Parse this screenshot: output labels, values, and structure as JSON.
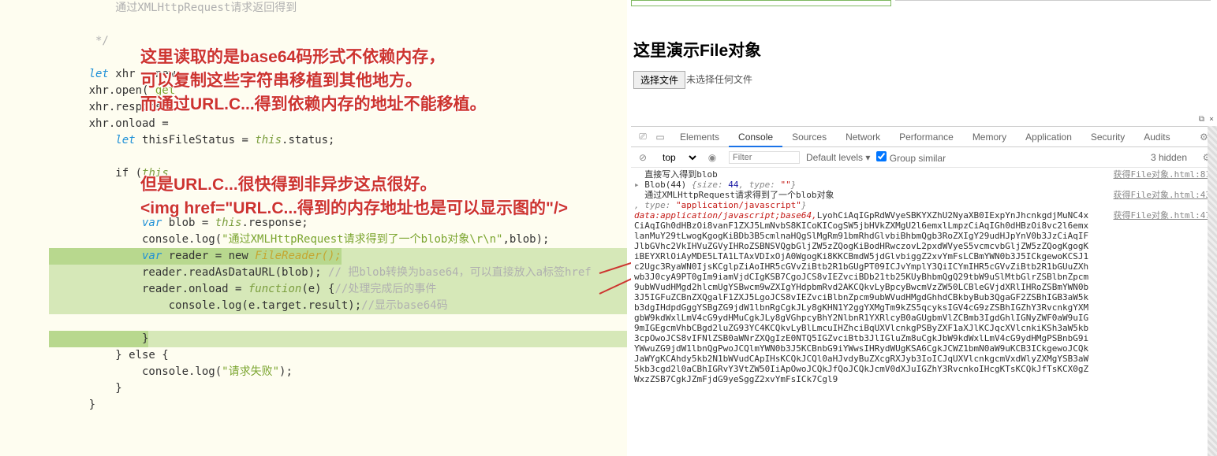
{
  "code": {
    "c1": "          通过XMLHttpRequest请求返回得到",
    "c2": "       */",
    "l1a": "      let ",
    "l1b": "xhr = new",
    "l2a": "      xhr.open(",
    "l2b": "'get",
    "l3": "      xhr.response",
    "l4": "      xhr.onload = ",
    "l5a": "          let ",
    "l5b": "thisFileStatus = ",
    "l5c": "this",
    "l5d": ".status;",
    "l6a": "          if (",
    "l6b": "this",
    "l7a": "              var ",
    "l7b": "blob = ",
    "l7c": "this",
    "l7d": ".response;",
    "l8a": "              console.log(",
    "l8b": "\"通过XMLHttpRequest请求得到了一个blob对象\\r\\n\"",
    "l8c": ",blob);",
    "l9a": "              var ",
    "l9b": "reader = new ",
    "l9c": "FileReader();",
    "l10a": "              reader.readAsDataURL(blob); ",
    "l10b": "// 把blob转换为base64，可以直接放入a标签href",
    "l11a": "              reader.onload = ",
    "l11b": "function",
    "l11c": "(e) {",
    "l11d": "//处理完成后的事件",
    "l12a": "                  console.log(e.target.result);",
    "l12b": "//显示base64码",
    "l13": "              }",
    "l14": "          } else {",
    "l15a": "              console.log(",
    "l15b": "\"请求失败\"",
    "l15c": ");",
    "l16": "          }",
    "l17": "      }"
  },
  "overlay": {
    "p1l1": "这里读取的是base64码形式不依赖内存，",
    "p1l2": "可以复制这些字符串移植到其他地方。",
    "p1l3": "而通过URL.C...得到依赖内存的地址不能移植。",
    "p2l1": "但是URL.C...很快得到非异步这点很好。",
    "p2l2": "<img href=\"URL.C...得到的内存地址也是可以显示图的\"/>"
  },
  "demo": {
    "title": "这里演示File对象",
    "choose_btn": "选择文件",
    "no_file": "未选择任何文件"
  },
  "devtools": {
    "tabs": {
      "elements": "Elements",
      "console": "Console",
      "sources": "Sources",
      "network": "Network",
      "performance": "Performance",
      "memory": "Memory",
      "application": "Application",
      "security": "Security",
      "audits": "Audits"
    },
    "ctx": "top",
    "filter_ph": "Filter",
    "levels": "Default levels ▾",
    "groupsim": "Group similar",
    "hidden": "3 hidden",
    "popout": "⧉  ×"
  },
  "console": {
    "l1": "直接写入得到blob",
    "src1": "获得File对象.html:81",
    "l2a": "Blob(44) ",
    "l2b": "{size: ",
    "l2c": "44",
    "l2d": ", type: ",
    "l2e": "\"\"",
    "l2f": "}",
    "l3": "通过XMLHttpRequest请求得到了一个blob对象",
    "src3": "获得File对象.html:43",
    "l4a": ", type: ",
    "l4b": "\"application/javascript\"",
    "l4c": "}",
    "src5": "获得File对象.html:47",
    "b64hd": "data:application/javascript;base64,",
    "b64": "LyohCiAqIGpRdWVyeSBKYXZhU2NyaXB0IExpYnJhcnkgdjMuNC4xCiAqIGh0dHBzOi8vanF1ZXJ5LmNvbS8KICoKICogSW5jbHVkZXMgU2l6emxlLmpzCiAqIGh0dHBzOi8vc2l6emxlanMuY29tLwogKgogKiBDb3B5cmlnaHQgSlMgRm91bmRhdGlvbiBhbmQgb3RoZXIgY29udHJpYnV0b3JzCiAqIFJlbGVhc2VkIHVuZGVyIHRoZSBNSVQgbGljZW5zZQogKiBodHRwczovL2pxdWVyeS5vcmcvbGljZW5zZQogKgogKiBEYXRlOiAyMDE5LTA1LTAxVDIxOjA0WgogKi8KKCBmdW5jdGlvbiggZ2xvYmFsLCBmYWN0b3J5ICkgewoKCSJ1c2Ugc3RyaWN0IjsKCglpZiAoIHR5cGVvZiBtb2R1bGUgPT09ICJvYmplY3QiICYmIHR5cGVvZiBtb2R1bGUuZXhwb3J0cyA9PT0gIm9iamVjdCIgKSB7CgoJCS8vIEZvciBDb21tb25KUyBhbmQgQ29tbW9uSlMtbGlrZSBlbnZpcm9ubWVudHMgd2hlcmUgYSBwcm9wZXIgYHdpbmRvd2AKCQkvLyBpcyBwcmVzZW50LCBleGVjdXRlIHRoZSBmYWN0b3J5IGFuZCBnZXQgalF1ZXJ5LgoJCS8vIEZvciBlbnZpcm9ubWVudHMgdGhhdCBkbyBub3QgaGF2ZSBhIGB3aW5kb3dgIHdpdGggYSBgZG9jdW1lbnRgCgkJLy8gKHN1Y2ggYXMgTm9kZS5qcyksIGV4cG9zZSBhIGZhY3RvcnkgYXMgbW9kdWxlLmV4cG9ydHMuCgkJLy8gVGhpcyBhY2NlbnR1YXRlcyB0aGUgbmVlZCBmb3IgdGhlIGNyZWF0aW9uIG9mIGEgcmVhbCBgd2luZG93YC4KCQkvLyBlLmcuIHZhciBqUXVlcnkgPSByZXF1aXJlKCJqcXVlcnkiKSh3aW5kb3cpOwoJCS8vIFNlZSB0aWNrZXQgIzE0NTQ5IGZvciBtb3JlIGluZm8uCgkJbW9kdWxlLmV4cG9ydHMgPSBnbG9iYWwuZG9jdW1lbnQgPwoJCQlmYWN0b3J5KCBnbG9iYWwsIHRydWUgKSA6CgkJCWZ1bmN0aW9uKCB3ICkgewoJCQkJaWYgKCAhdy5kb2N1bWVudCApIHsKCQkJCQl0aHJvdyBuZXcgRXJyb3IoICJqUXVlcnkgcmVxdWlyZXMgYSB3aW5kb3cgd2l0aCBhIGRvY3VtZW50IiApOwoJCQkJfQoJCQkJcmV0dXJuIGZhY3RvcnkoIHcgKTsKCQkJfTsKCX0gZWxzZSB7CgkJZmFjdG9yeSggZ2xvYmFsICk7Cgl9"
  }
}
